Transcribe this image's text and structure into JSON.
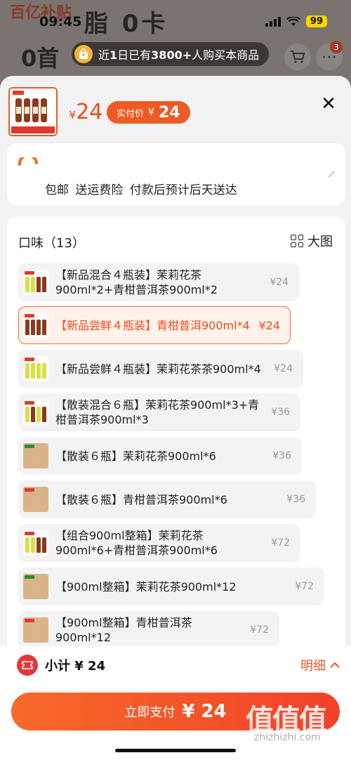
{
  "status": {
    "time": "09:45",
    "battery": "99"
  },
  "background": {
    "logo": "百亿补贴",
    "title": "脂 0卡",
    "subtitle": "0首",
    "more_badge": "3"
  },
  "recent": {
    "prefix": "近",
    "days": "1",
    "mid": "日已有",
    "count": "3800+",
    "suffix": "人购买本商品"
  },
  "header": {
    "price_symbol": "¥",
    "price": "24",
    "net_label": "实付价",
    "net_symbol": "¥",
    "net_price": "24"
  },
  "shipping": {
    "text": "包邮  送运费险  付款后预计后天送达"
  },
  "options": {
    "title": "口味（13）",
    "big_image_label": "大图",
    "items": [
      {
        "label": "【新品混合４瓶装】茉莉花茶900ml*2+青柑普洱茶900ml*2",
        "price": "¥24"
      },
      {
        "label": "【新品尝鲜４瓶装】青柑普洱900ml*4",
        "price": "¥24"
      },
      {
        "label": "【新品尝鲜４瓶装】茉莉花茶茶900ml*4",
        "price": "¥24"
      },
      {
        "label": "【散装混合６瓶】茉莉花茶900ml*3+青柑普洱茶900ml*3",
        "price": "¥36"
      },
      {
        "label": "【散装６瓶】茉莉花茶900ml*6",
        "price": "¥36"
      },
      {
        "label": "【散装６瓶】青柑普洱茶900ml*6",
        "price": "¥36"
      },
      {
        "label": "【组合900ml整箱】茉莉花茶900ml*6+青柑普洱茶900ml*6",
        "price": "¥72"
      },
      {
        "label": "【900ml整箱】茉莉花茶900ml*12",
        "price": "¥72"
      },
      {
        "label": "【900ml整箱】青柑普洱茶900ml*12",
        "price": "¥72"
      }
    ]
  },
  "footer": {
    "subtotal": "小计 ¥ 24",
    "detail": "明细",
    "pay_label": "立即支付",
    "pay_amount": "¥ 24"
  },
  "watermark": {
    "logo": "值值值",
    "url": "zhizhizhi.com"
  },
  "colors": {
    "accent": "#ee4c1f",
    "pay_start": "#f76a2a",
    "pay_end": "#f0422a"
  }
}
